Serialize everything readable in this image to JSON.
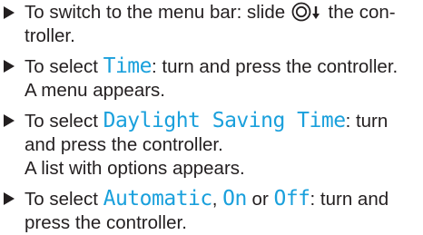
{
  "steps": [
    {
      "pre": "To switch to the menu bar: slide ",
      "icon": "controller-slide-down-icon",
      "post": " the con-troller."
    },
    {
      "pre": "To select ",
      "hl": "Time",
      "post": ": turn and press the controller.",
      "line2": "A menu appears."
    },
    {
      "pre": "To select ",
      "hl": "Daylight Saving Time",
      "post": ": turn and press the controller.",
      "line2": "A list with options appears."
    },
    {
      "pre": "To select ",
      "hl1": "Automatic",
      "sep1": ", ",
      "hl2": "On",
      "sep2": " or ",
      "hl3": "Off",
      "post": ": turn and press the controller."
    }
  ],
  "colors": {
    "text": "#231f20",
    "highlight": "#1aa0dc"
  }
}
